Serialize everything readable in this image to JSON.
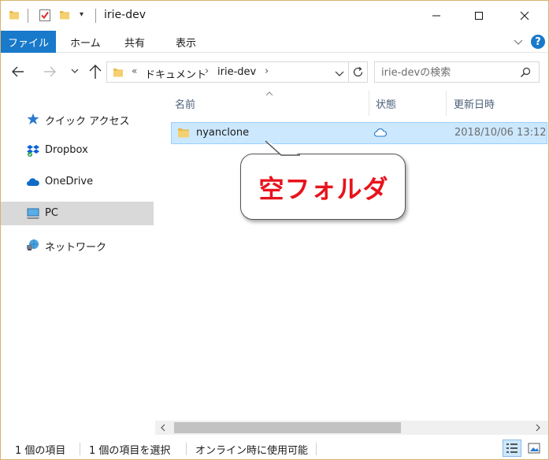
{
  "window": {
    "title": "irie-dev"
  },
  "ribbon": {
    "tabs": [
      "ファイル",
      "ホーム",
      "共有",
      "表示"
    ]
  },
  "address": {
    "segments": [
      "ドキュメント",
      "irie-dev"
    ],
    "overflow": "«"
  },
  "search": {
    "placeholder": "irie-devの検索"
  },
  "sidebar": {
    "items": [
      {
        "label": "クイック アクセス",
        "icon": "star-icon"
      },
      {
        "label": "Dropbox",
        "icon": "dropbox-icon"
      },
      {
        "label": "OneDrive",
        "icon": "onedrive-icon"
      },
      {
        "label": "PC",
        "icon": "pc-icon",
        "selected": true
      },
      {
        "label": "ネットワーク",
        "icon": "network-icon"
      }
    ]
  },
  "columns": {
    "name": "名前",
    "status": "状態",
    "modified": "更新日時"
  },
  "files": [
    {
      "name": "nyanclone",
      "status_icon": "cloud-icon",
      "modified": "2018/10/06 13:12"
    }
  ],
  "callout": {
    "text": "空フォルダ",
    "color": "#e8131c"
  },
  "statusbar": {
    "item_count": "1 個の項目",
    "selected_count": "1 個の項目を選択",
    "availability": "オンライン時に使用可能"
  },
  "colors": {
    "accent": "#1979ca",
    "selection": "#cce8ff"
  }
}
